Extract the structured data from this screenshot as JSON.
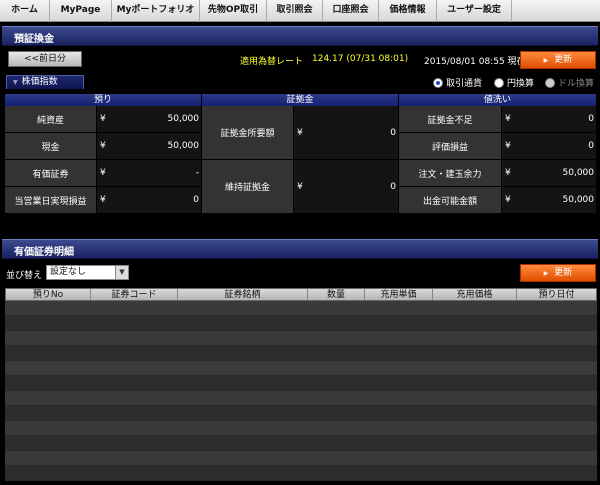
{
  "nav": {
    "tabs": [
      "ホーム",
      "MyPage",
      "Myポートフォリオ",
      "先物OP取引",
      "取引照会",
      "口座照会",
      "価格情報",
      "ユーザー設定"
    ]
  },
  "deposit": {
    "title": "預証換金",
    "prev_day_button": "<<前日分",
    "rate_label": "適用為替レート",
    "rate_value": "124.17 (07/31 08:01)",
    "now_datetime": "2015/08/01 08:55 現在",
    "update_button": "更新",
    "index_tab": "株価指数",
    "radio_options": [
      {
        "label": "取引通貨",
        "selected": true
      },
      {
        "label": "円換算",
        "selected": false
      },
      {
        "label": "ドル換算",
        "selected": false,
        "disabled": true
      }
    ]
  },
  "balance": {
    "headers": [
      "預り",
      "証拠金",
      "値洗い"
    ],
    "yen": "¥",
    "left_rows": [
      {
        "label": "純資産",
        "value": "50,000"
      },
      {
        "label": "現金",
        "value": "50,000"
      },
      {
        "label": "有価証券",
        "value": "-"
      },
      {
        "label": "当営業日実現損益",
        "value": "0"
      }
    ],
    "middle_rows": [
      {
        "label": "証拠金所要額",
        "value": "0"
      },
      {
        "label": "維持証拠金",
        "value": "0"
      }
    ],
    "right_rows": [
      {
        "label": "証拠金不足",
        "value": "0"
      },
      {
        "label": "評価損益",
        "value": "0"
      },
      {
        "label": "注文・建玉余力",
        "value": "50,000"
      },
      {
        "label": "出金可能金額",
        "value": "50,000"
      }
    ]
  },
  "holdings": {
    "title": "有価証券明細",
    "sort_label": "並び替え",
    "sort_value": "設定なし",
    "update_button": "更新",
    "columns": [
      "預りNo",
      "証券コード",
      "証券銘柄",
      "数量",
      "充用単価",
      "充用価格",
      "預り日付"
    ],
    "empty_rows": 12
  },
  "colors": {
    "accent_orange": "#f06010",
    "header_navy": "#1a2260",
    "rate_yellow": "#ffff33"
  }
}
